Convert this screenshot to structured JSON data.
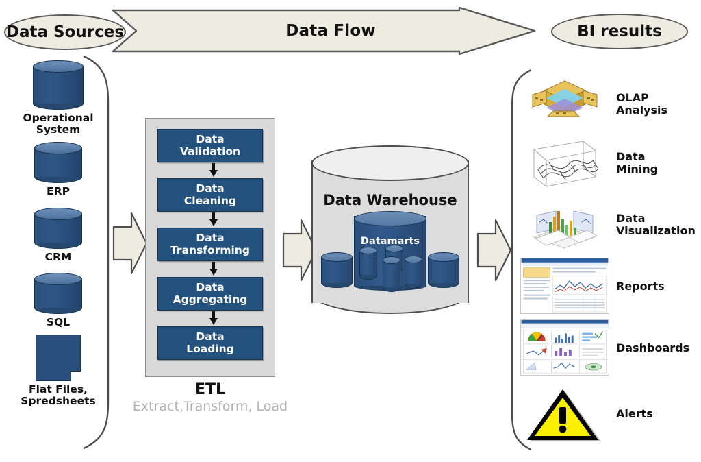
{
  "header": {
    "left_pill": "Data Sources",
    "flow_label": "Data Flow",
    "right_pill": "BI results"
  },
  "colors": {
    "arrow_fill": "#eeece1",
    "arrow_stroke": "#595959",
    "box_blue": "#24527e",
    "cylinder_blue": "#2b4f7d",
    "cylinder_top": "#5b7fab",
    "panel_gray": "#d9d9d9",
    "warehouse_gray": "#dcdcdc",
    "subtitle_gray": "#b2b2b2",
    "alert_yellow": "#f8f000"
  },
  "sources": {
    "items": [
      {
        "label": "Operational\nSystem",
        "icon": "database-cylinder-icon"
      },
      {
        "label": "ERP",
        "icon": "database-cylinder-icon"
      },
      {
        "label": "CRM",
        "icon": "database-cylinder-icon"
      },
      {
        "label": "SQL",
        "icon": "database-cylinder-icon"
      },
      {
        "label": "Flat Files,\nSpredsheets",
        "icon": "flat-file-icon"
      }
    ]
  },
  "etl": {
    "title": "ETL",
    "subtitle": "Extract,Transform,\nLoad",
    "steps": [
      {
        "label": "Data\nValidation"
      },
      {
        "label": "Data\nCleaning"
      },
      {
        "label": "Data\nTransforming"
      },
      {
        "label": "Data\nAggregating"
      },
      {
        "label": "Data\nLoading"
      }
    ]
  },
  "warehouse": {
    "title": "Data Warehouse",
    "inner_label": "Datamarts"
  },
  "bi_results": {
    "items": [
      {
        "label": "OLAP\nAnalysis",
        "icon": "olap-cube-icon"
      },
      {
        "label": "Data\nMining",
        "icon": "surface-mesh-icon"
      },
      {
        "label": "Data\nVisualization",
        "icon": "3d-chart-icon"
      },
      {
        "label": "Reports",
        "icon": "report-page-icon"
      },
      {
        "label": "Dashboards",
        "icon": "dashboard-grid-icon"
      },
      {
        "label": "Alerts",
        "icon": "warning-triangle-icon"
      }
    ]
  },
  "connectors": {
    "sources_to_etl": "block-arrow-right",
    "etl_to_warehouse": "block-arrow-right",
    "warehouse_to_bi": "block-arrow-right"
  }
}
